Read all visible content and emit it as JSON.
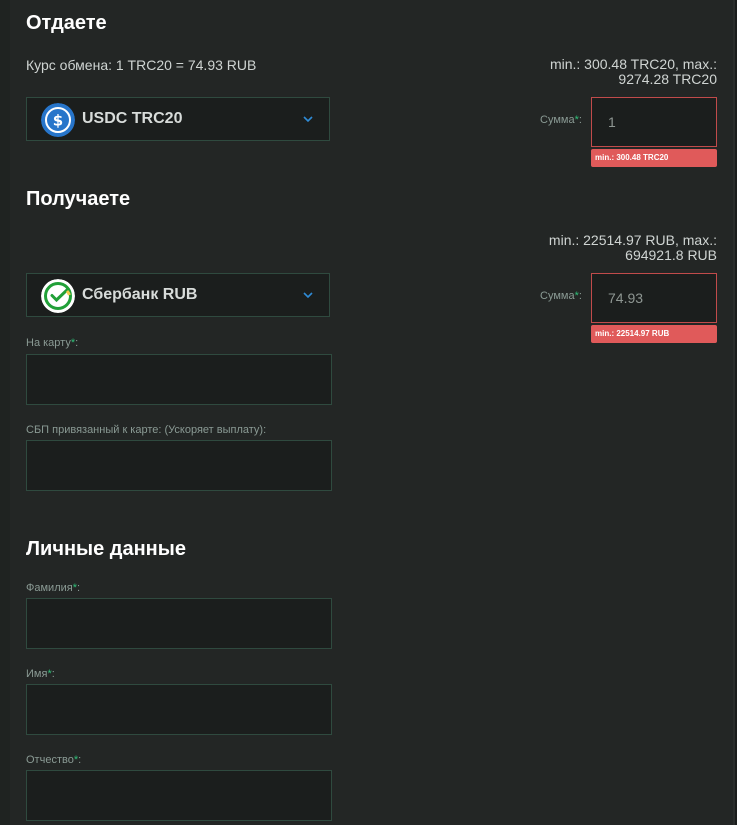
{
  "give": {
    "heading": "Отдаете",
    "rate": "Курс обмена: 1 TRC20 = 74.93 RUB",
    "limits_line1": "min.: 300.48 TRC20, max.:",
    "limits_line2": "9274.28 TRC20",
    "currency": "USDC TRC20",
    "sum_label": "Сумма",
    "sum_value": "1",
    "error": "min.: 300.48 TRC20"
  },
  "get": {
    "heading": "Получаете",
    "limits_line1": "min.: 22514.97 RUB, max.:",
    "limits_line2": "694921.8 RUB",
    "currency": "Сбербанк RUB",
    "sum_label": "Сумма",
    "sum_value": "74.93",
    "error": "min.: 22514.97 RUB",
    "card_label": "На карту",
    "sbp_label": "СБП привязанный к карте: (Ускоряет выплату):"
  },
  "personal": {
    "heading": "Личные данные",
    "last_name_label": "Фамилия",
    "first_name_label": "Имя",
    "middle_name_label": "Отчество"
  },
  "required_mark": "*",
  "icons": {
    "usdc": "usdc-logo-icon",
    "sber": "sberbank-logo-icon",
    "chevron": "chevron-down-icon"
  },
  "colors": {
    "accent_green": "#2fbf78",
    "error_red": "#e05a5a",
    "usdc_blue": "#2775ca",
    "chevron_blue": "#2f8bd6"
  }
}
